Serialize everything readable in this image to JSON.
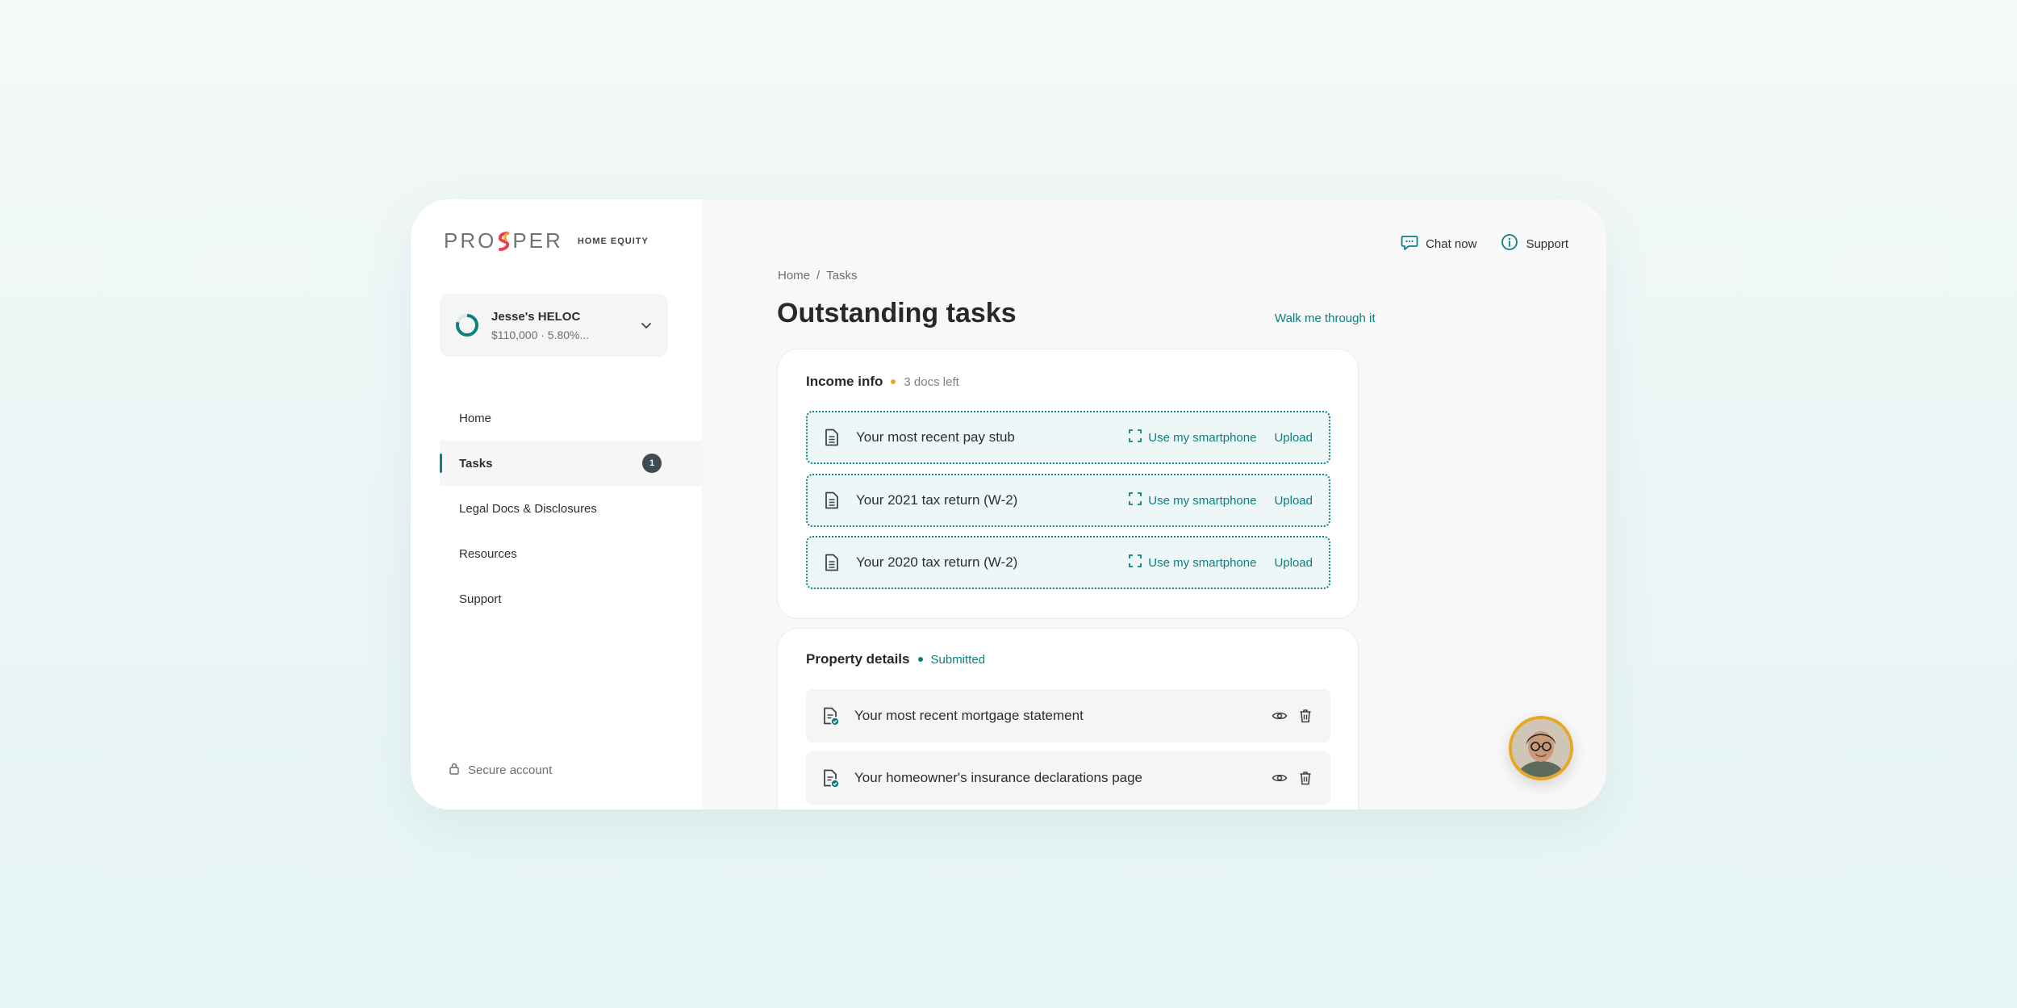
{
  "brand": {
    "logo_text_a": "PRO",
    "logo_text_b": "PER",
    "sub": "HOME EQUITY"
  },
  "loan": {
    "name": "Jesse's HELOC",
    "detail": "$110,000 · 5.80%..."
  },
  "nav": {
    "items": [
      {
        "label": "Home"
      },
      {
        "label": "Tasks",
        "badge": "1"
      },
      {
        "label": "Legal Docs & Disclosures"
      },
      {
        "label": "Resources"
      },
      {
        "label": "Support"
      }
    ]
  },
  "footer": {
    "secure": "Secure account"
  },
  "top": {
    "chat": "Chat now",
    "support": "Support"
  },
  "breadcrumb": {
    "home": "Home",
    "sep": "/",
    "current": "Tasks"
  },
  "page": {
    "title": "Outstanding tasks",
    "walk": "Walk me through it"
  },
  "income": {
    "title": "Income info",
    "status": "3 docs left",
    "status_color": "#e6a824",
    "docs": [
      {
        "label": "Your most recent pay stub",
        "smartphone": "Use my smartphone",
        "upload": "Upload"
      },
      {
        "label": "Your 2021 tax return (W-2)",
        "smartphone": "Use my smartphone",
        "upload": "Upload"
      },
      {
        "label": "Your 2020 tax return (W-2)",
        "smartphone": "Use my smartphone",
        "upload": "Upload"
      }
    ]
  },
  "property": {
    "title": "Property details",
    "status": "Submitted",
    "status_color": "#0c8080",
    "docs": [
      {
        "label": "Your most recent mortgage statement"
      },
      {
        "label": "Your homeowner's insurance declarations page"
      }
    ]
  },
  "colors": {
    "accent": "#0c8080",
    "warning": "#e6a824",
    "badge": "#3d4c55"
  },
  "icons": [
    "chat-icon",
    "info-icon",
    "document-icon",
    "scan-icon",
    "eye-icon",
    "trash-icon",
    "lock-icon",
    "chevron-down-icon",
    "progress-ring-icon"
  ]
}
